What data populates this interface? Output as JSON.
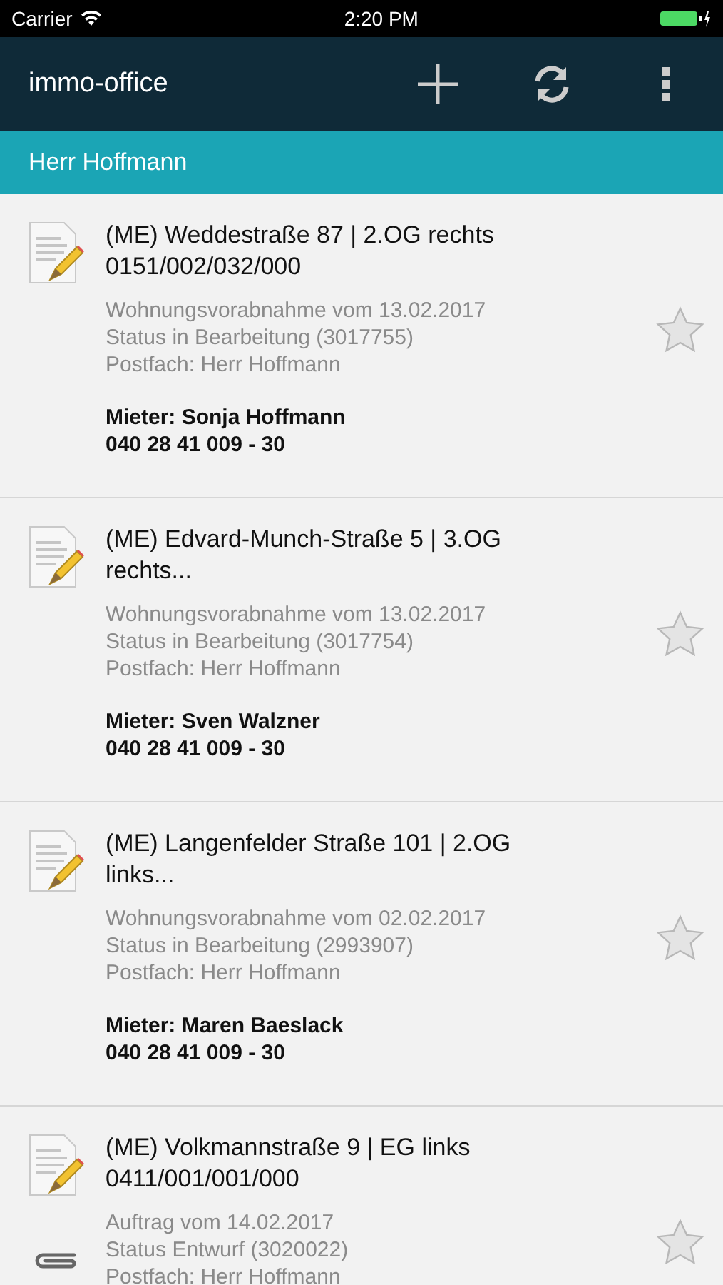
{
  "status_bar": {
    "carrier": "Carrier",
    "time": "2:20 PM"
  },
  "app_bar": {
    "title": "immo-office"
  },
  "section_header": {
    "title": "Herr Hoffmann"
  },
  "items": [
    {
      "title": "(ME) Weddestraße 87 | 2.OG rechts",
      "subtitle": "0151/002/032/000",
      "details": [
        "Wohnungsvorabnahme vom 13.02.2017",
        "Status in Bearbeitung (3017755)",
        "Postfach: Herr Hoffmann"
      ],
      "tenant": "Mieter: Sonja Hoffmann",
      "phone": "040 28 41 009 - 30",
      "favorite": false,
      "attachment": false
    },
    {
      "title": "(ME) Edvard-Munch-Straße 5 | 3.OG rechts...",
      "details": [
        "Wohnungsvorabnahme vom 13.02.2017",
        "Status in Bearbeitung (3017754)",
        "Postfach: Herr Hoffmann"
      ],
      "tenant": "Mieter: Sven Walzner",
      "phone": "040 28 41 009 - 30",
      "favorite": false,
      "attachment": false
    },
    {
      "title": "(ME) Langenfelder Straße 101 | 2.OG links...",
      "details": [
        "Wohnungsvorabnahme vom 02.02.2017",
        "Status in Bearbeitung (2993907)",
        "Postfach: Herr Hoffmann"
      ],
      "tenant": "Mieter: Maren Baeslack",
      "phone": "040 28 41 009 - 30",
      "favorite": false,
      "attachment": false
    },
    {
      "title": "(ME) Volkmannstraße 9 | EG links",
      "subtitle": "0411/001/001/000",
      "details": [
        "Auftrag vom 14.02.2017",
        "Status Entwurf (3020022)",
        "Postfach: Herr Hoffmann"
      ],
      "favorite": false,
      "attachment": true
    }
  ]
}
